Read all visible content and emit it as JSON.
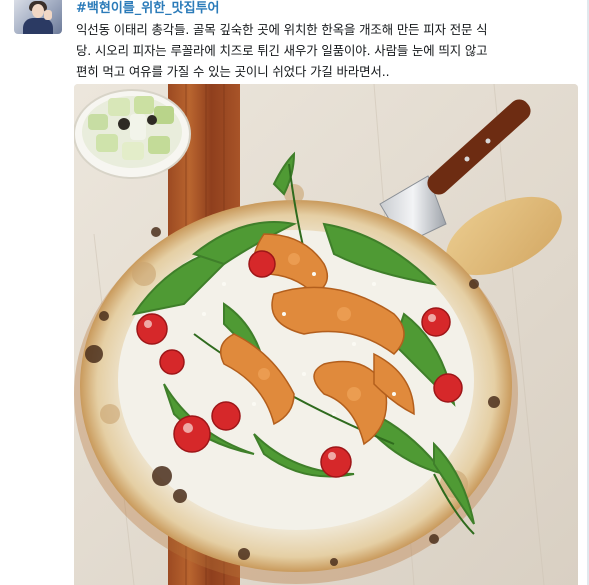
{
  "tweet": {
    "hashtag": "#백현이를_위한_맛집투어",
    "text_lines": [
      "익선동 이태리 총각들. 골목 깊숙한 곳에 위치한 한옥을 개조해 만든 피자 전문 식",
      "당. 시오리 피자는 루꼴라에 치즈로 튀긴 새우가 일품이야. 사람들 눈에 띄지 않고",
      "편히 먹고 여유를 가질 수 있는 곳이니 쉬었다 가길 바라면서.."
    ]
  },
  "colors": {
    "hashtag": "#2b7bb9",
    "text": "#14171a",
    "border": "#e1e8ed"
  },
  "icons": {
    "avatar": "user-avatar-photo"
  }
}
